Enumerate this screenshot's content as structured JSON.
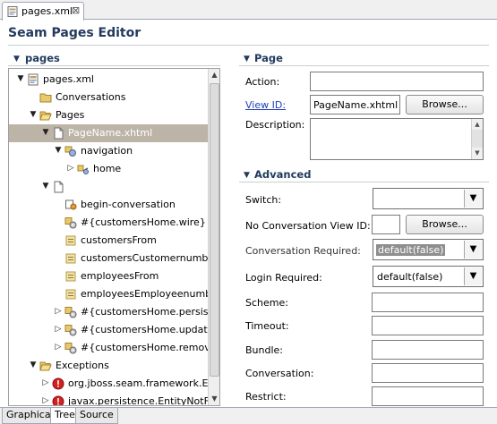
{
  "editor_tab": {
    "label": "pages.xml",
    "close_glyph": "⊠"
  },
  "editor_title": "Seam Pages Editor",
  "tree_section": {
    "title": "pages"
  },
  "tree": {
    "rows": [
      {
        "label": "pages.xml",
        "icon": "xml-file-icon",
        "twisty": "▼"
      },
      {
        "label": "Conversations",
        "icon": "folder-icon",
        "twisty": ""
      },
      {
        "label": "Pages",
        "icon": "folder-open-icon",
        "twisty": "▼"
      },
      {
        "label": "PageName.xhtml",
        "icon": "page-file-icon",
        "twisty": "▼"
      },
      {
        "label": "navigation",
        "icon": "navigation-icon",
        "twisty": "▼"
      },
      {
        "label": "home",
        "icon": "navigation-rule-icon",
        "twisty": "▷"
      },
      {
        "label": "",
        "icon": "page-file-icon",
        "twisty": "▼"
      },
      {
        "label": "begin-conversation",
        "icon": "action-icon",
        "twisty": ""
      },
      {
        "label": "#{customersHome.wire}",
        "icon": "action-gear-icon",
        "twisty": ""
      },
      {
        "label": "customersFrom",
        "icon": "param-icon",
        "twisty": ""
      },
      {
        "label": "customersCustomernumbe",
        "icon": "param-icon",
        "twisty": ""
      },
      {
        "label": "employeesFrom",
        "icon": "param-icon",
        "twisty": ""
      },
      {
        "label": "employeesEmployeenumbe",
        "icon": "param-icon",
        "twisty": ""
      },
      {
        "label": "#{customersHome.persist",
        "icon": "action-gear-icon",
        "twisty": "▷"
      },
      {
        "label": "#{customersHome.update",
        "icon": "action-gear-icon",
        "twisty": "▷"
      },
      {
        "label": "#{customersHome.remove",
        "icon": "action-gear-icon",
        "twisty": "▷"
      },
      {
        "label": "Exceptions",
        "icon": "folder-open-icon",
        "twisty": "▼"
      },
      {
        "label": "org.jboss.seam.framework.Ent",
        "icon": "exception-icon",
        "twisty": "▷"
      },
      {
        "label": "javax.persistence.EntityNotFou",
        "icon": "exception-icon",
        "twisty": "▷"
      }
    ],
    "selected_index": 3
  },
  "page_section": {
    "title": "Page",
    "action_label": "Action:",
    "action_value": "",
    "viewid_label": "View ID:",
    "viewid_value": "PageName.xhtml",
    "browse_label": "Browse...",
    "description_label": "Description:",
    "description_value": ""
  },
  "advanced_section": {
    "title": "Advanced",
    "switch_label": "Switch:",
    "switch_value": "",
    "noconv_label": "No Conversation View ID:",
    "noconv_value": "",
    "browse_label": "Browse...",
    "conv_required_label": "Conversation Required:",
    "conv_required_value": "default(false)",
    "login_required_label": "Login Required:",
    "login_required_value": "default(false)",
    "scheme_label": "Scheme:",
    "timeout_label": "Timeout:",
    "bundle_label": "Bundle:",
    "conversation_label": "Conversation:",
    "restrict_label": "Restrict:"
  },
  "bottom_tabs": [
    "Graphical",
    "Tree",
    "Source"
  ],
  "active_bottom_tab": "Tree",
  "colors": {
    "header_blue": "#223a5e",
    "selection": "#bdb4a8",
    "link": "#1f3fb8"
  }
}
